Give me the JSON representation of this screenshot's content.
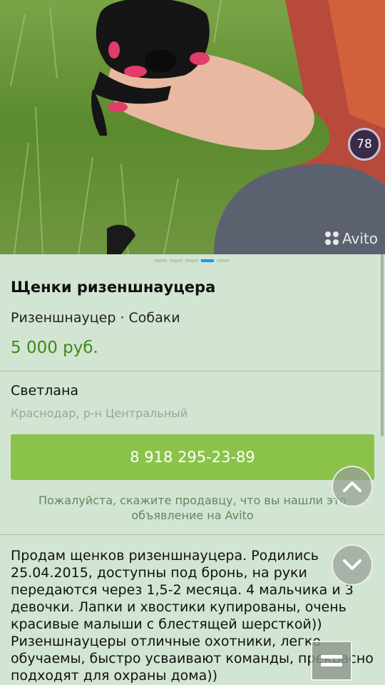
{
  "photo": {
    "watermark": "Avito",
    "photo_counter": "78",
    "pager_count": 5,
    "pager_active_index": 3
  },
  "listing": {
    "title": "Щенки ризеншнауцера",
    "category": "Ризеншнауцер · Собаки",
    "price": "5 000 руб."
  },
  "seller": {
    "name": "Светлана",
    "location": "Краснодар, р-н Центральный"
  },
  "contact": {
    "phone_button_label": "8 918 295-23-89",
    "hint": "Пожалуйста, скажите продавцу, что вы нашли это объявление на Avito"
  },
  "description": {
    "text": "Продам щенков ризеншнауцера. Родились 25.04.2015, доступны под бронь, на руки передаются через 1,5-2 месяца. 4 мальчика и 3 девочки. Лапки и хвостики купированы, очень красивые малыши с блестящей шерсткой))\nРизеншнауцеры отличные охотники, легко обучаемы, быстро усваивают команды, прекрасно подходят для охраны дома))"
  },
  "icons": {
    "scroll_up": "chevron-up-icon",
    "scroll_down": "chevron-down-icon",
    "menu": "menu-icon"
  },
  "colors": {
    "background": "#d2e4d2",
    "price": "#3c8a16",
    "call_button": "#8bc34a",
    "pager_active": "#1e9ae0",
    "hint_text": "#5f8a5a"
  }
}
